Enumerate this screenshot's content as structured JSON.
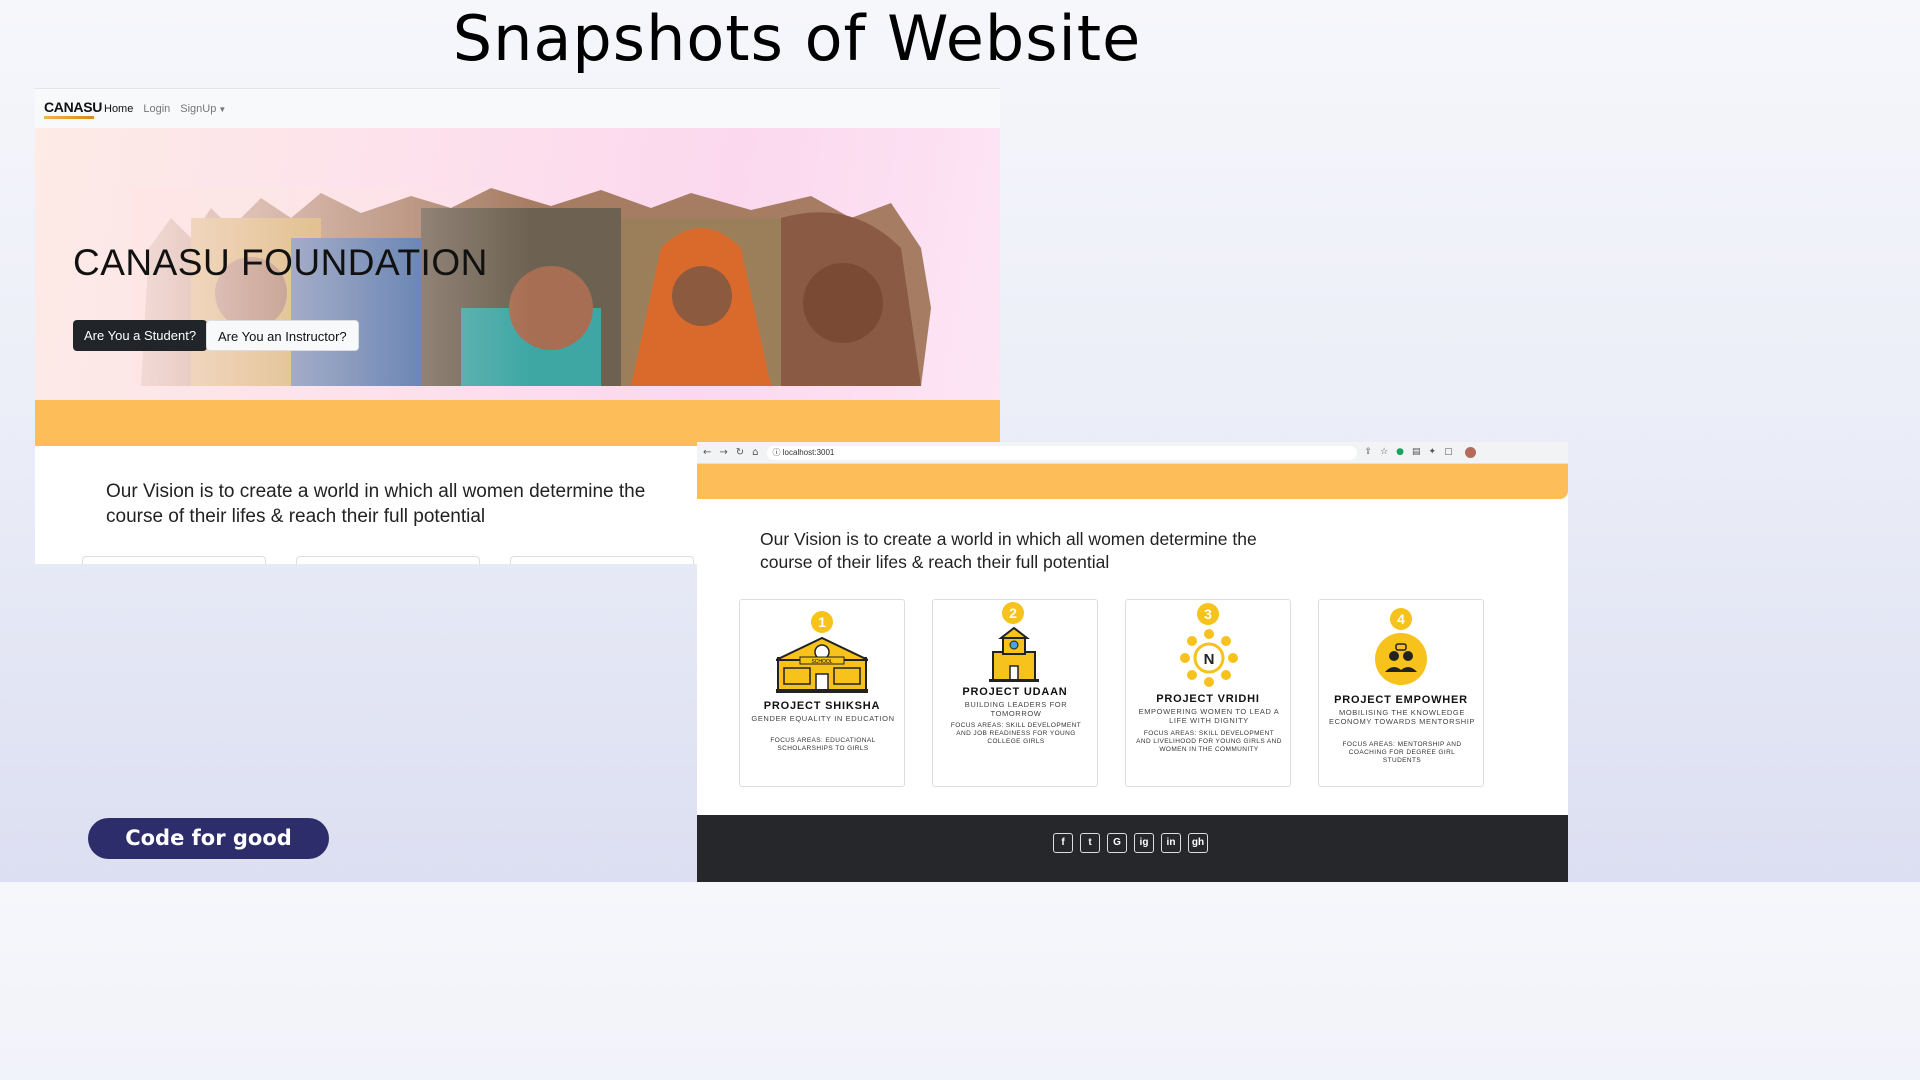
{
  "slide": {
    "title": "Snapshots of Website",
    "badge": "Code for good"
  },
  "left_site": {
    "logo": "CANASU",
    "nav": {
      "home": "Home",
      "login": "Login",
      "signup": "SignUp"
    },
    "hero_title": "CANASU FOUNDATION",
    "student_btn": "Are You a Student?",
    "instructor_btn": "Are You an Instructor?",
    "vision": "Our Vision is to create a world in which all women determine the course of their lifes & reach their full potential"
  },
  "right_site": {
    "url": "localhost:3001",
    "vision": "Our Vision is to create a world in which all women determine the course of their lifes & reach their full potential",
    "projects": [
      {
        "num": "1",
        "title": "PROJECT SHIKSHA",
        "subtitle": "GENDER EQUALITY IN EDUCATION",
        "focus": "FOCUS AREAS: EDUCATIONAL SCHOLARSHIPS TO GIRLS"
      },
      {
        "num": "2",
        "title": "PROJECT UDAAN",
        "subtitle": "BUILDING LEADERS FOR TOMORROW",
        "focus": "FOCUS AREAS: SKILL DEVELOPMENT AND JOB READINESS FOR YOUNG COLLEGE GIRLS"
      },
      {
        "num": "3",
        "title": "PROJECT VRIDHI",
        "subtitle": "EMPOWERING WOMEN TO LEAD A LIFE WITH DIGNITY",
        "focus": "FOCUS AREAS: SKILL DEVELOPMENT AND LIVELIHOOD FOR YOUNG GIRLS AND WOMEN IN THE COMMUNITY"
      },
      {
        "num": "4",
        "title": "PROJECT EMPOWHER",
        "subtitle": "MOBILISING THE KNOWLEDGE ECONOMY TOWARDS MENTORSHIP",
        "focus": "FOCUS AREAS: MENTORSHIP AND COACHING FOR DEGREE GIRL STUDENTS"
      }
    ],
    "school_sign": "SCHOOL",
    "vridhi_mark": "N",
    "social": [
      "f",
      "t",
      "G",
      "ig",
      "in",
      "gh"
    ]
  },
  "colors": {
    "accent_orange": "#fdbd58",
    "badge_navy": "#2e2d6b",
    "yellow": "#f6c21b",
    "footer": "#25272b"
  },
  "icons": [
    "back-arrow-icon",
    "forward-arrow-icon",
    "reload-icon",
    "home-icon",
    "info-icon",
    "facebook-icon",
    "twitter-icon",
    "google-icon",
    "instagram-icon",
    "linkedin-icon",
    "github-icon"
  ]
}
